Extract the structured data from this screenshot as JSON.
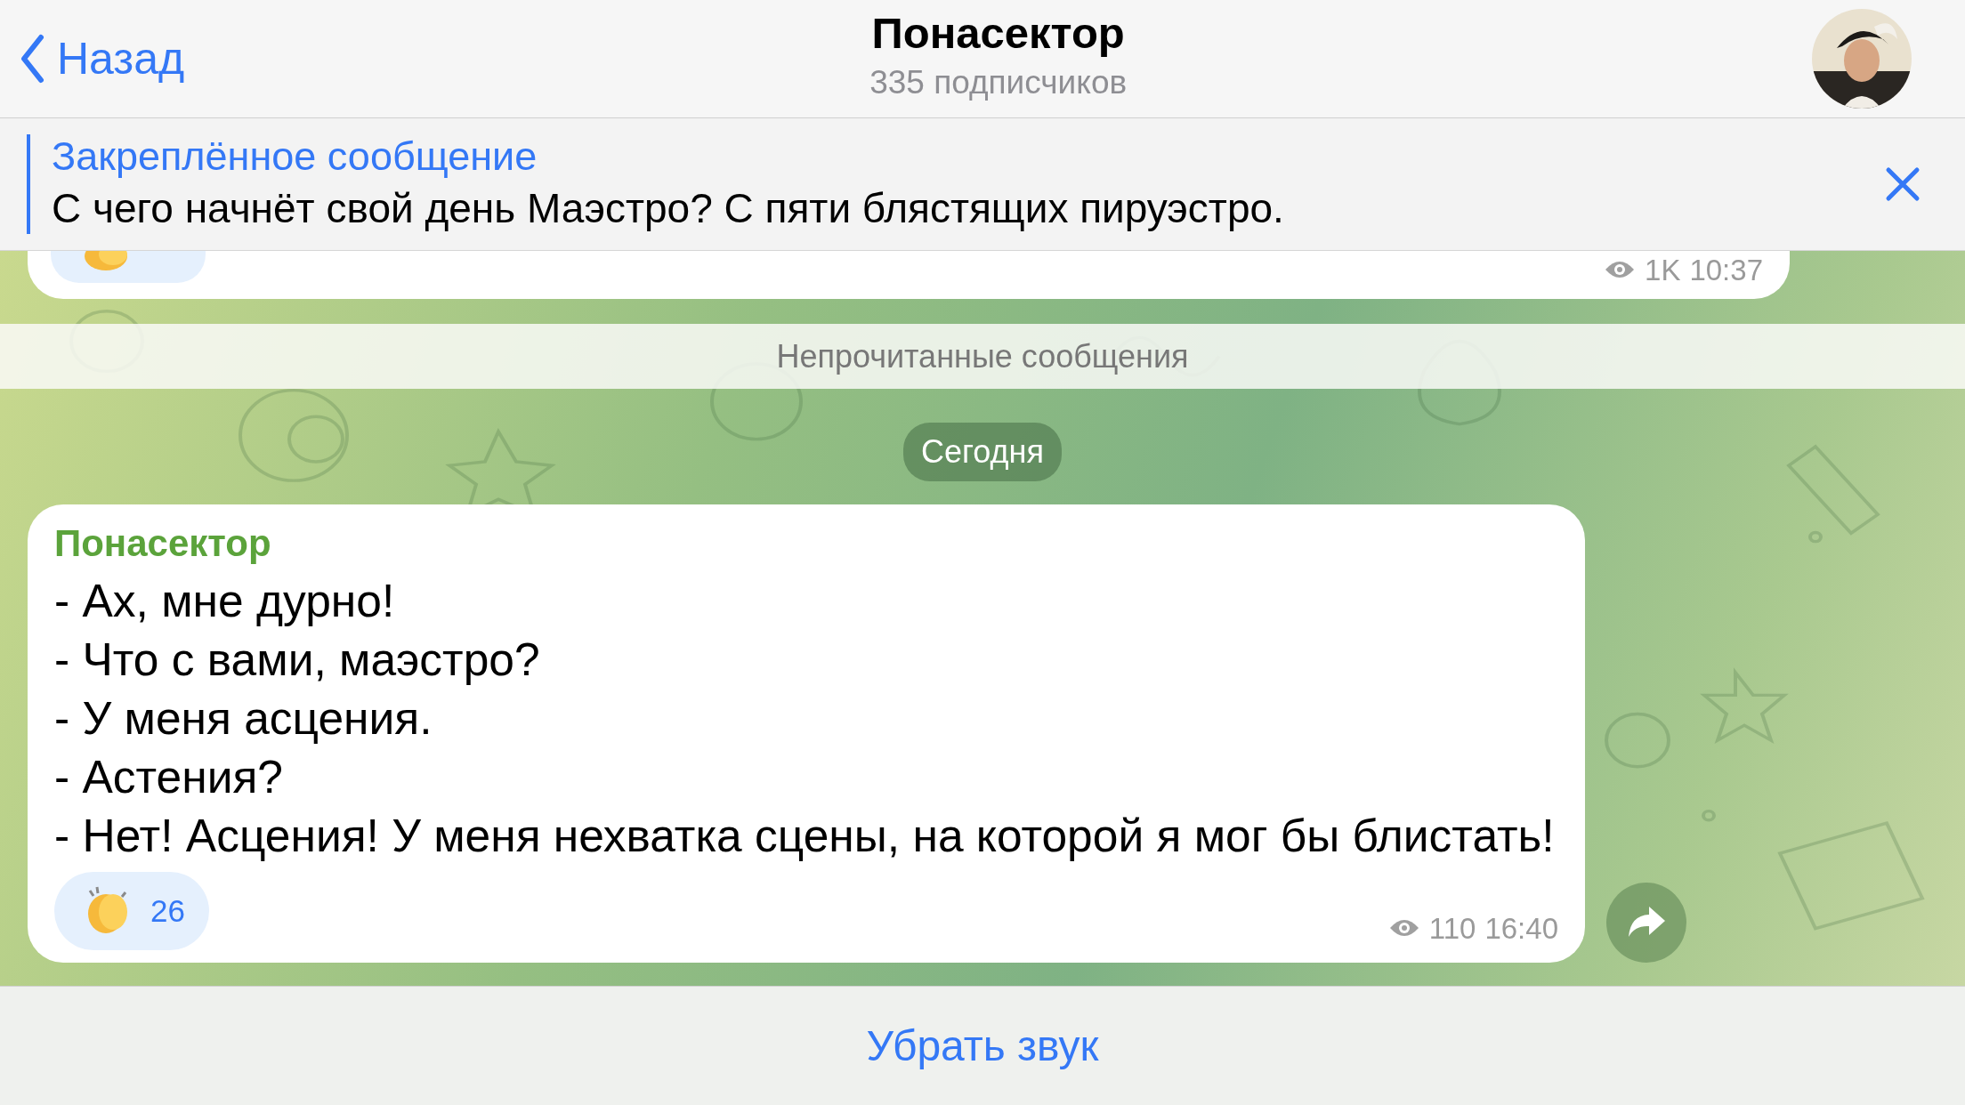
{
  "header": {
    "back": "Назад",
    "title": "Понасектор",
    "subtitle": "335 подписчиков"
  },
  "pinned": {
    "title": "Закреплённое сообщение",
    "text": "С чего начнёт свой день Маэстро? С пяти блястящих пируэстро."
  },
  "previous_message": {
    "views": "1K",
    "time": "10:37"
  },
  "unread_divider": "Непрочитанные сообщения",
  "date_badge": "Сегодня",
  "message": {
    "sender": "Понасектор",
    "lines": [
      "- Ах, мне дурно!",
      "- Что с вами, маэстро?",
      "- У меня асцения.",
      "- Астения?",
      "- Нет! Асцения! У меня нехватка сцены, на которой я мог бы блистать!"
    ],
    "reaction": {
      "count": "26"
    },
    "views": "110",
    "time": "16:40"
  },
  "bottom_button": "Убрать звук"
}
